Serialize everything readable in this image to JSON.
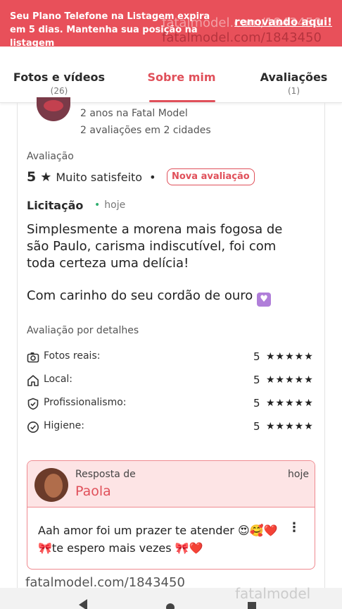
{
  "banner": {
    "message": "Seu Plano Telefone na Listagem expira em 5 dias. Mantenha sua posição na listagem",
    "cta": "renovando aqui!"
  },
  "watermark": {
    "url_light": "fatalmodel.com/1843450",
    "url": "fatalmodel.com/1843450",
    "logo": "fatalmodel"
  },
  "tabs": [
    {
      "label": "Fotos e vídeos",
      "count": "(26)"
    },
    {
      "label": "Sobre mim",
      "count": ""
    },
    {
      "label": "Avaliações",
      "count": "(1)"
    }
  ],
  "active_tab": "Sobre mim",
  "reviewer": {
    "since": "2 anos na Fatal Model",
    "reviews": "2 avaliações em 2 cidades"
  },
  "review": {
    "rating_label": "Avaliação",
    "rating_value": "5",
    "rating_text": "Muito satisfeito",
    "badge": "Nova avaliação",
    "service": "Licitação",
    "when": "hoje",
    "paragraph_1": "Simplesmente a morena mais fogosa de são Paulo, carisma indiscutível, foi com toda certeza uma delícia!",
    "paragraph_2": "Com carinho do seu cordão de ouro",
    "details_label": "Avaliação por detalhes",
    "criteria": [
      {
        "name": "Fotos reais:",
        "score": "5",
        "stars": "★★★★★",
        "icon": "camera-icon"
      },
      {
        "name": "Local:",
        "score": "5",
        "stars": "★★★★★",
        "icon": "home-icon"
      },
      {
        "name": "Profissionalismo:",
        "score": "5",
        "stars": "★★★★★",
        "icon": "shield-check-icon"
      },
      {
        "name": "Higiene:",
        "score": "5",
        "stars": "★★★★★",
        "icon": "check-circle-icon"
      }
    ]
  },
  "reply": {
    "label": "Resposta de",
    "name": "Paola",
    "time": "hoje",
    "text_1": "Aah amor foi um prazer te atender 😍🥰❤️",
    "text_2": "🎀te espero mais vezes 🎀❤️"
  },
  "colors": {
    "brand": "#e0505a",
    "banner": "#e8505a",
    "reply_bg": "#fde4e5",
    "online": "#2fae6f"
  }
}
